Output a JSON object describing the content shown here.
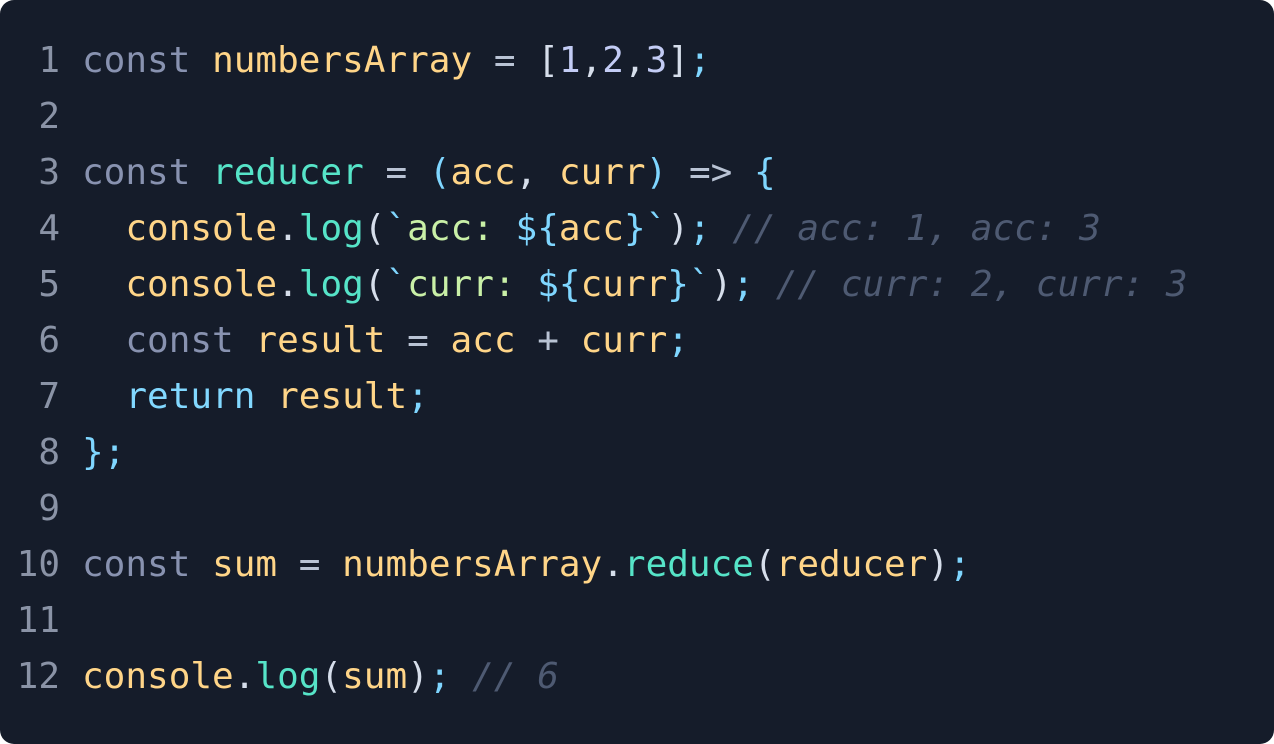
{
  "editor": {
    "lines": [
      {
        "number": "1",
        "tokens": [
          {
            "text": "const",
            "type": "kw"
          },
          {
            "text": " ",
            "type": "punc"
          },
          {
            "text": "numbersArray",
            "type": "var"
          },
          {
            "text": " = ",
            "type": "op"
          },
          {
            "text": "[",
            "type": "punc"
          },
          {
            "text": "1",
            "type": "num"
          },
          {
            "text": ",",
            "type": "punc"
          },
          {
            "text": "2",
            "type": "num"
          },
          {
            "text": ",",
            "type": "punc"
          },
          {
            "text": "3",
            "type": "num"
          },
          {
            "text": "]",
            "type": "punc"
          },
          {
            "text": ";",
            "type": "semi"
          }
        ]
      },
      {
        "number": "2",
        "tokens": []
      },
      {
        "number": "3",
        "tokens": [
          {
            "text": "const",
            "type": "kw"
          },
          {
            "text": " ",
            "type": "punc"
          },
          {
            "text": "reducer",
            "type": "fn"
          },
          {
            "text": " = ",
            "type": "op"
          },
          {
            "text": "(",
            "type": "brace"
          },
          {
            "text": "acc",
            "type": "var"
          },
          {
            "text": ", ",
            "type": "punc"
          },
          {
            "text": "curr",
            "type": "var"
          },
          {
            "text": ")",
            "type": "brace"
          },
          {
            "text": " => ",
            "type": "op"
          },
          {
            "text": "{",
            "type": "brace"
          }
        ]
      },
      {
        "number": "4",
        "tokens": [
          {
            "text": "  ",
            "type": "punc"
          },
          {
            "text": "console",
            "type": "var"
          },
          {
            "text": ".",
            "type": "punc"
          },
          {
            "text": "log",
            "type": "fn"
          },
          {
            "text": "(",
            "type": "punc"
          },
          {
            "text": "`",
            "type": "tpl"
          },
          {
            "text": "acc: ",
            "type": "str"
          },
          {
            "text": "${",
            "type": "tpl"
          },
          {
            "text": "acc",
            "type": "var"
          },
          {
            "text": "}",
            "type": "tpl"
          },
          {
            "text": "`",
            "type": "tpl"
          },
          {
            "text": ")",
            "type": "punc"
          },
          {
            "text": ";",
            "type": "semi"
          },
          {
            "text": " ",
            "type": "punc"
          },
          {
            "text": "// acc: 1, acc: 3",
            "type": "comment"
          }
        ]
      },
      {
        "number": "5",
        "tokens": [
          {
            "text": "  ",
            "type": "punc"
          },
          {
            "text": "console",
            "type": "var"
          },
          {
            "text": ".",
            "type": "punc"
          },
          {
            "text": "log",
            "type": "fn"
          },
          {
            "text": "(",
            "type": "punc"
          },
          {
            "text": "`",
            "type": "tpl"
          },
          {
            "text": "curr: ",
            "type": "str"
          },
          {
            "text": "${",
            "type": "tpl"
          },
          {
            "text": "curr",
            "type": "var"
          },
          {
            "text": "}",
            "type": "tpl"
          },
          {
            "text": "`",
            "type": "tpl"
          },
          {
            "text": ")",
            "type": "punc"
          },
          {
            "text": ";",
            "type": "semi"
          },
          {
            "text": " ",
            "type": "punc"
          },
          {
            "text": "// curr: 2, curr: 3",
            "type": "comment"
          }
        ]
      },
      {
        "number": "6",
        "tokens": [
          {
            "text": "  ",
            "type": "punc"
          },
          {
            "text": "const",
            "type": "kw"
          },
          {
            "text": " ",
            "type": "punc"
          },
          {
            "text": "result",
            "type": "var"
          },
          {
            "text": " = ",
            "type": "op"
          },
          {
            "text": "acc",
            "type": "var"
          },
          {
            "text": " + ",
            "type": "op"
          },
          {
            "text": "curr",
            "type": "var"
          },
          {
            "text": ";",
            "type": "semi"
          }
        ]
      },
      {
        "number": "7",
        "tokens": [
          {
            "text": "  ",
            "type": "punc"
          },
          {
            "text": "return",
            "type": "kw2"
          },
          {
            "text": " ",
            "type": "punc"
          },
          {
            "text": "result",
            "type": "var"
          },
          {
            "text": ";",
            "type": "semi"
          }
        ]
      },
      {
        "number": "8",
        "tokens": [
          {
            "text": "}",
            "type": "brace"
          },
          {
            "text": ";",
            "type": "semi"
          }
        ]
      },
      {
        "number": "9",
        "tokens": []
      },
      {
        "number": "10",
        "tokens": [
          {
            "text": "const",
            "type": "kw"
          },
          {
            "text": " ",
            "type": "punc"
          },
          {
            "text": "sum",
            "type": "var"
          },
          {
            "text": " = ",
            "type": "op"
          },
          {
            "text": "numbersArray",
            "type": "var"
          },
          {
            "text": ".",
            "type": "punc"
          },
          {
            "text": "reduce",
            "type": "fn"
          },
          {
            "text": "(",
            "type": "punc"
          },
          {
            "text": "reducer",
            "type": "var"
          },
          {
            "text": ")",
            "type": "punc"
          },
          {
            "text": ";",
            "type": "semi"
          }
        ]
      },
      {
        "number": "11",
        "tokens": []
      },
      {
        "number": "12",
        "tokens": [
          {
            "text": "console",
            "type": "var"
          },
          {
            "text": ".",
            "type": "punc"
          },
          {
            "text": "log",
            "type": "fn"
          },
          {
            "text": "(",
            "type": "punc"
          },
          {
            "text": "sum",
            "type": "var"
          },
          {
            "text": ")",
            "type": "punc"
          },
          {
            "text": ";",
            "type": "semi"
          },
          {
            "text": " ",
            "type": "punc"
          },
          {
            "text": "// 6",
            "type": "comment"
          }
        ]
      }
    ]
  },
  "colors": {
    "background": "#151c2a",
    "line_number": "#8a93a6",
    "keyword": "#8892b0",
    "return_keyword": "#82d8ff",
    "variable": "#ffd588",
    "function": "#56e4c8",
    "number": "#c3ccf5",
    "string": "#c9f0a7",
    "comment": "#4e5a72"
  }
}
